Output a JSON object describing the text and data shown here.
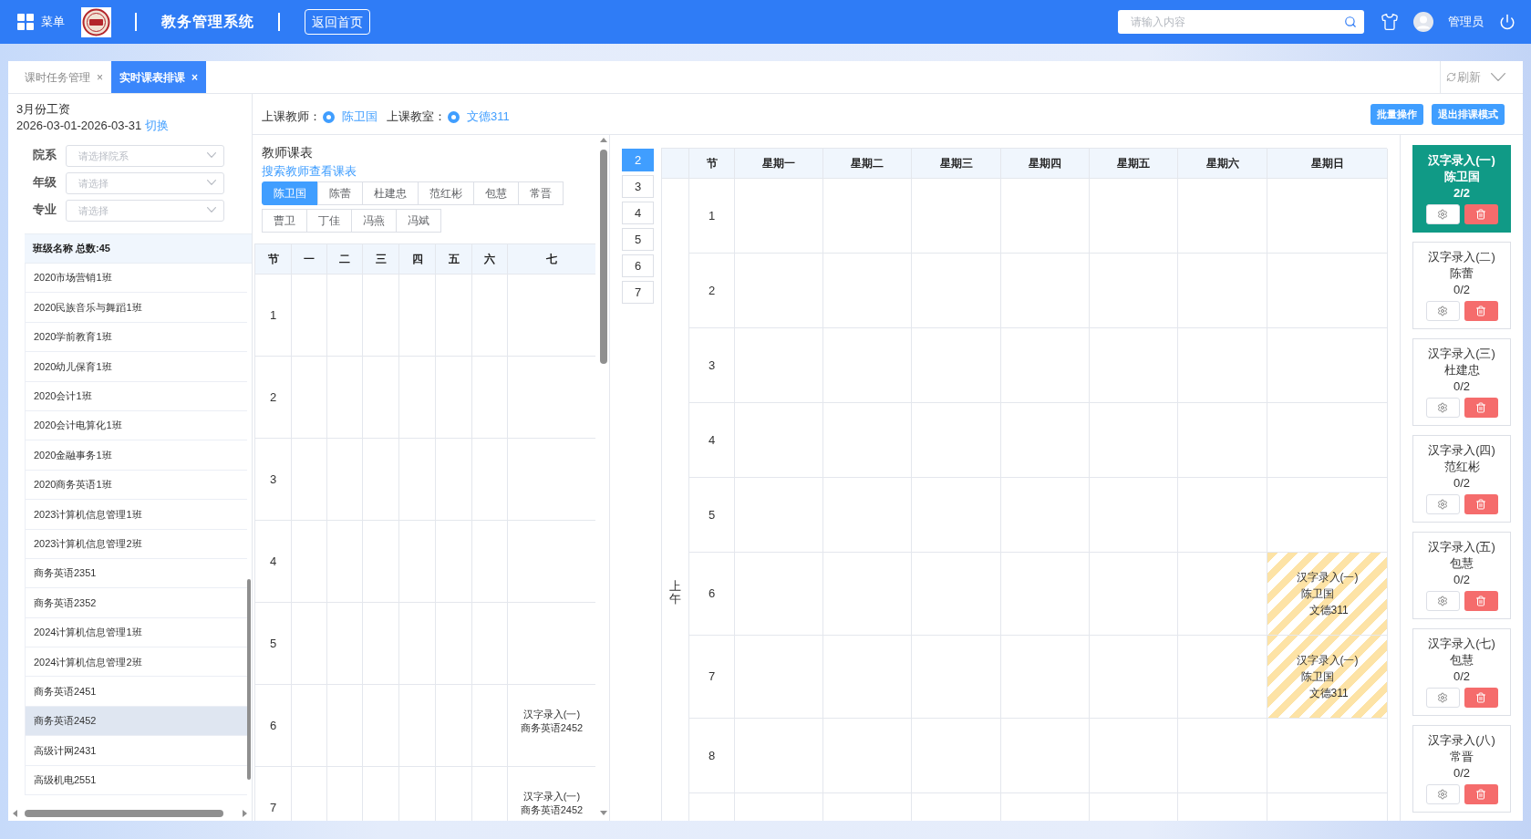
{
  "top_bar": {
    "menu_label": "菜单",
    "system_title": "教务管理系统",
    "home_button": "返回首页",
    "search": {
      "placeholder": "请输入内容"
    },
    "user_name": "管理员"
  },
  "tabs": [
    {
      "label": "课时任务管理",
      "close": "×",
      "selected": false
    },
    {
      "label": "实时课表排课",
      "close": "×",
      "selected": true
    }
  ],
  "refresh_button": "刷新",
  "sidebar": {
    "title": "3月份工资",
    "date_range": "2026-03-01-2026-03-31",
    "switch_link": "切换",
    "filters": [
      {
        "label": "院系",
        "placeholder": "请选择院系"
      },
      {
        "label": "年级",
        "placeholder": "请选择"
      },
      {
        "label": "专业",
        "placeholder": "请选择"
      }
    ],
    "class_table": {
      "header": "班级名称 总数:45",
      "rows": [
        {
          "name": "2020市场营销1班",
          "selected": false
        },
        {
          "name": "2020民族音乐与舞蹈1班",
          "selected": false
        },
        {
          "name": "2020学前教育1班",
          "selected": false
        },
        {
          "name": "2020幼儿保育1班",
          "selected": false
        },
        {
          "name": "2020会计1班",
          "selected": false
        },
        {
          "name": "2020会计电算化1班",
          "selected": false
        },
        {
          "name": "2020金融事务1班",
          "selected": false
        },
        {
          "name": "2020商务英语1班",
          "selected": false
        },
        {
          "name": "2023计算机信息管理1班",
          "selected": false
        },
        {
          "name": "2023计算机信息管理2班",
          "selected": false
        },
        {
          "name": "商务英语2351",
          "selected": false
        },
        {
          "name": "商务英语2352",
          "selected": false
        },
        {
          "name": "2024计算机信息管理1班",
          "selected": false
        },
        {
          "name": "2024计算机信息管理2班",
          "selected": false
        },
        {
          "name": "商务英语2451",
          "selected": false
        },
        {
          "name": "商务英语2452",
          "selected": true
        },
        {
          "name": "高级计网2431",
          "selected": false
        },
        {
          "name": "高级机电2551",
          "selected": false
        }
      ]
    }
  },
  "selection_bar": {
    "teacher": {
      "label": "上课教师：",
      "value": "陈卫国",
      "checked": true
    },
    "room": {
      "label": "上课教室：",
      "value": "文德311",
      "checked": true
    },
    "buttons": [
      "批量操作",
      "退出排课模式"
    ]
  },
  "teacher_timetable": {
    "title": "教师课表",
    "search_link": "搜索教师查看课表",
    "teachers": [
      {
        "name": "陈卫国",
        "selected": true
      },
      {
        "name": "陈蕾",
        "selected": false
      },
      {
        "name": "杜建忠",
        "selected": false
      },
      {
        "name": "范红彬",
        "selected": false
      },
      {
        "name": "包慧",
        "selected": false
      },
      {
        "name": "常晋",
        "selected": false
      },
      {
        "name": "曹卫",
        "selected": false
      },
      {
        "name": "丁佳",
        "selected": false
      },
      {
        "name": "冯燕",
        "selected": false
      },
      {
        "name": "冯斌",
        "selected": false
      }
    ],
    "columns": [
      "节",
      "一",
      "二",
      "三",
      "四",
      "五",
      "六",
      "七"
    ],
    "rows": [
      {
        "period": "1",
        "cells": [
          null,
          null,
          null,
          null,
          null,
          null,
          null
        ]
      },
      {
        "period": "2",
        "cells": [
          null,
          null,
          null,
          null,
          null,
          null,
          null
        ]
      },
      {
        "period": "3",
        "cells": [
          null,
          null,
          null,
          null,
          null,
          null,
          null
        ]
      },
      {
        "period": "4",
        "cells": [
          null,
          null,
          null,
          null,
          null,
          null,
          null
        ]
      },
      {
        "period": "5",
        "cells": [
          null,
          null,
          null,
          null,
          null,
          null,
          null
        ]
      },
      {
        "period": "6",
        "cells": [
          null,
          null,
          null,
          null,
          null,
          null,
          {
            "course": "汉字录入(一)",
            "class": "商务英语2452"
          }
        ]
      },
      {
        "period": "7",
        "cells": [
          null,
          null,
          null,
          null,
          null,
          null,
          {
            "course": "汉字录入(一)",
            "class": "商务英语2452"
          }
        ]
      }
    ]
  },
  "period_selector": [
    {
      "label": "2",
      "selected": true
    },
    {
      "label": "3",
      "selected": false
    },
    {
      "label": "4",
      "selected": false
    },
    {
      "label": "5",
      "selected": false
    },
    {
      "label": "6",
      "selected": false
    },
    {
      "label": "7",
      "selected": false
    }
  ],
  "schedule": {
    "session_label": "上午",
    "columns": [
      "节",
      "星期一",
      "星期二",
      "星期三",
      "星期四",
      "星期五",
      "星期六",
      "星期日"
    ],
    "rows": [
      {
        "period": "1",
        "cells": [
          null,
          null,
          null,
          null,
          null,
          null,
          null
        ]
      },
      {
        "period": "2",
        "cells": [
          null,
          null,
          null,
          null,
          null,
          null,
          null
        ]
      },
      {
        "period": "3",
        "cells": [
          null,
          null,
          null,
          null,
          null,
          null,
          null
        ]
      },
      {
        "period": "4",
        "cells": [
          null,
          null,
          null,
          null,
          null,
          null,
          null
        ]
      },
      {
        "period": "5",
        "cells": [
          null,
          null,
          null,
          null,
          null,
          null,
          null
        ]
      },
      {
        "period": "6",
        "cells": [
          null,
          null,
          null,
          null,
          null,
          null,
          {
            "course": "汉字录入(一)",
            "teacher": "陈卫国",
            "room": "文德311"
          }
        ]
      },
      {
        "period": "7",
        "cells": [
          null,
          null,
          null,
          null,
          null,
          null,
          {
            "course": "汉字录入(一)",
            "teacher": "陈卫国",
            "room": "文德311"
          }
        ]
      },
      {
        "period": "8",
        "cells": [
          null,
          null,
          null,
          null,
          null,
          null,
          null
        ]
      }
    ]
  },
  "course_cards": [
    {
      "title": "汉字录入(一)",
      "teacher": "陈卫国",
      "progress": "2/2",
      "selected": true
    },
    {
      "title": "汉字录入(二)",
      "teacher": "陈蕾",
      "progress": "0/2",
      "selected": false
    },
    {
      "title": "汉字录入(三)",
      "teacher": "杜建忠",
      "progress": "0/2",
      "selected": false
    },
    {
      "title": "汉字录入(四)",
      "teacher": "范红彬",
      "progress": "0/2",
      "selected": false
    },
    {
      "title": "汉字录入(五)",
      "teacher": "包慧",
      "progress": "0/2",
      "selected": false
    },
    {
      "title": "汉字录入(七)",
      "teacher": "包慧",
      "progress": "0/2",
      "selected": false
    },
    {
      "title": "汉字录入(八)",
      "teacher": "常晋",
      "progress": "0/2",
      "selected": false
    }
  ]
}
